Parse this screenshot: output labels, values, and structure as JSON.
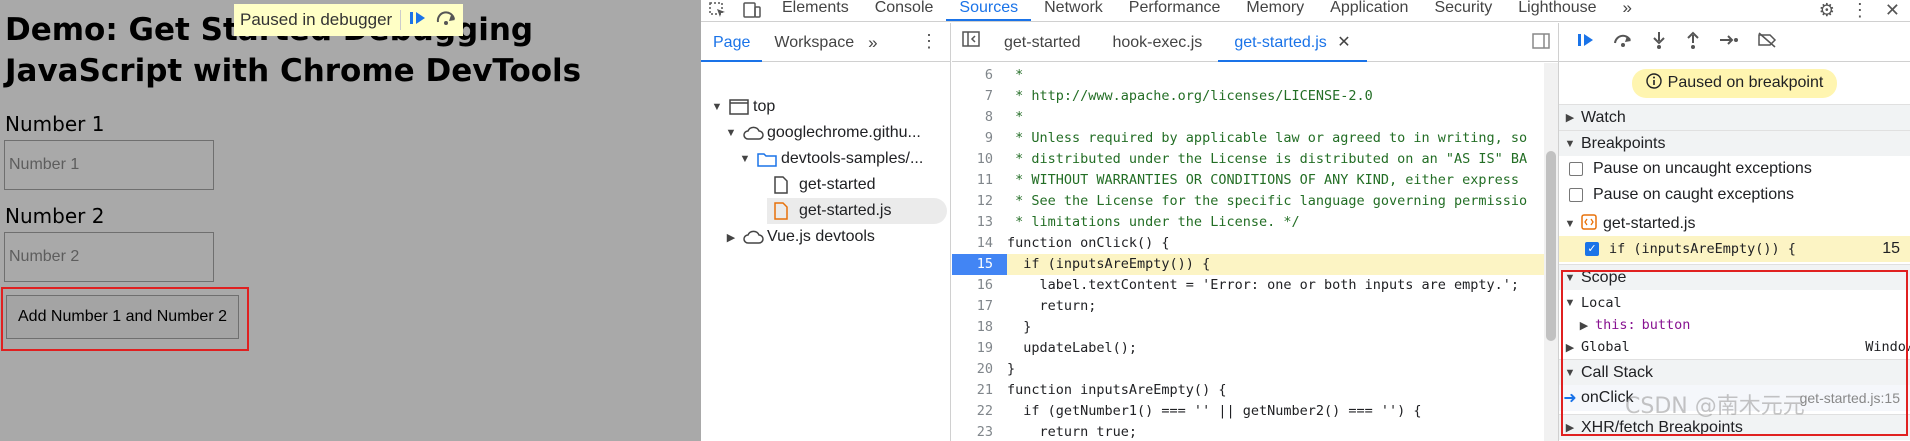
{
  "page": {
    "title": "Demo: Get Started Debugging JavaScript with Chrome DevTools",
    "number1_label": "Number 1",
    "number1_placeholder": "Number 1",
    "number2_label": "Number 2",
    "number2_placeholder": "Number 2",
    "add_button": "Add Number 1 and Number 2",
    "debugger_banner": "Paused in debugger"
  },
  "devtools": {
    "main_tabs": [
      "Elements",
      "Console",
      "Sources",
      "Network",
      "Performance",
      "Memory",
      "Application",
      "Security",
      "Lighthouse"
    ],
    "active_tab": "Sources",
    "navigator": {
      "tabs": [
        "Page",
        "Workspace"
      ],
      "active_tab": "Page",
      "tree": {
        "top": "top",
        "origin": "googlechrome.githu...",
        "folder": "devtools-samples/...",
        "file1": "get-started",
        "file2": "get-started.js",
        "vue": "Vue.js devtools"
      }
    },
    "editor": {
      "tabs": [
        "get-started",
        "hook-exec.js",
        "get-started.js"
      ],
      "active_tab": "get-started.js",
      "breakpoint_line": 15,
      "lines": [
        {
          "n": "6",
          "text": " *"
        },
        {
          "n": "7",
          "text": " * http://www.apache.org/licenses/LICENSE-2.0"
        },
        {
          "n": "8",
          "text": " *"
        },
        {
          "n": "9",
          "text": " * Unless required by applicable law or agreed to in writing, so"
        },
        {
          "n": "10",
          "text": " * distributed under the License is distributed on an \"AS IS\" BA"
        },
        {
          "n": "11",
          "text": " * WITHOUT WARRANTIES OR CONDITIONS OF ANY KIND, either express"
        },
        {
          "n": "12",
          "text": " * See the License for the specific language governing permissio"
        },
        {
          "n": "13",
          "text": " * limitations under the License. */"
        },
        {
          "n": "14",
          "text": "function onClick() {"
        },
        {
          "n": "15",
          "text": "  if (inputsAreEmpty()) {"
        },
        {
          "n": "16",
          "text": "    label.textContent = 'Error: one or both inputs are empty.';"
        },
        {
          "n": "17",
          "text": "    return;"
        },
        {
          "n": "18",
          "text": "  }"
        },
        {
          "n": "19",
          "text": "  updateLabel();"
        },
        {
          "n": "20",
          "text": "}"
        },
        {
          "n": "21",
          "text": "function inputsAreEmpty() {"
        },
        {
          "n": "22",
          "text": "  if (getNumber1() === '' || getNumber2() === '') {"
        },
        {
          "n": "23",
          "text": "    return true;"
        }
      ]
    },
    "sidebar": {
      "paused_message": "Paused on breakpoint",
      "watch": "Watch",
      "breakpoints": "Breakpoints",
      "pause_uncaught": "Pause on uncaught exceptions",
      "pause_caught": "Pause on caught exceptions",
      "bp_file": "get-started.js",
      "bp_code": "if (inputsAreEmpty()) {",
      "bp_line": "15",
      "scope": "Scope",
      "local": "Local",
      "this_key": "this:",
      "this_value": "button",
      "global": "Global",
      "global_value": "Window",
      "call_stack": "Call Stack",
      "frame_name": "onClick",
      "frame_location": "get-started.js:15",
      "xhr": "XHR/fetch Breakpoints"
    },
    "watermark": "CSDN @南木元元"
  },
  "colors": {
    "accent": "#1a73e8",
    "annotation": "#e02020",
    "paused_bg": "#fff5b0",
    "breakpoint_bg": "#fcf4c4"
  }
}
